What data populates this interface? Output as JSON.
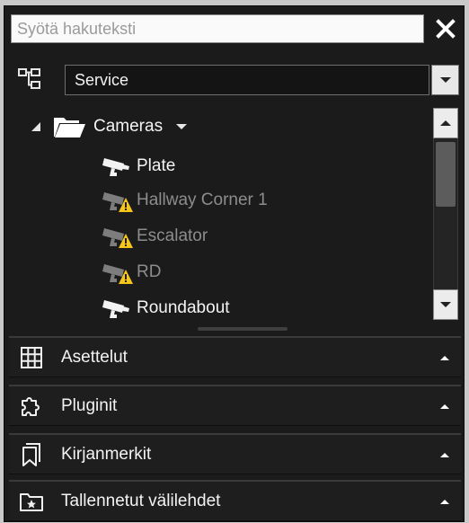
{
  "search": {
    "placeholder": "Syötä hakuteksti",
    "value": ""
  },
  "hierarchy": {
    "selected": "Service"
  },
  "tree": {
    "group_label": "Cameras",
    "cameras": [
      {
        "label": "Plate",
        "status": "ok"
      },
      {
        "label": "Hallway Corner 1",
        "status": "warning"
      },
      {
        "label": "Escalator",
        "status": "warning"
      },
      {
        "label": "RD",
        "status": "warning"
      },
      {
        "label": "Roundabout",
        "status": "ok"
      }
    ]
  },
  "sections": [
    {
      "label": "Asettelut",
      "icon": "grid-icon"
    },
    {
      "label": "Pluginit",
      "icon": "puzzle-icon"
    },
    {
      "label": "Kirjanmerkit",
      "icon": "bookmark-icon"
    },
    {
      "label": "Tallennetut välilehdet",
      "icon": "saved-tab-icon"
    }
  ],
  "colors": {
    "panel": "#1b1b1b",
    "warning": "#f5c518",
    "text": "#f4f4f4",
    "dim_text": "#8d8d8d"
  }
}
